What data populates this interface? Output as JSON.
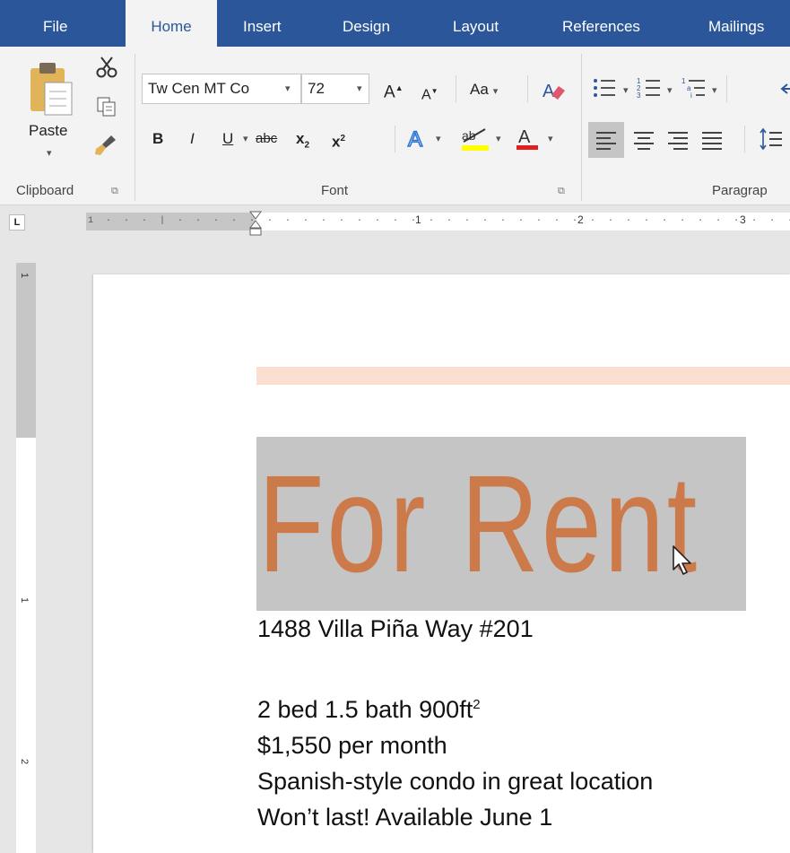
{
  "tabs": {
    "file": "File",
    "home": "Home",
    "insert": "Insert",
    "design": "Design",
    "layout": "Layout",
    "references": "References",
    "mailings": "Mailings"
  },
  "ribbon": {
    "clipboard": {
      "paste_label": "Paste",
      "group_label": "Clipboard"
    },
    "font": {
      "font_name": "Tw Cen MT Co",
      "font_size": "72",
      "change_case": "Aa",
      "bold": "B",
      "italic": "I",
      "underline": "U",
      "strikethrough": "abc",
      "subscript": "x",
      "subscript_mark": "2",
      "superscript": "x",
      "superscript_mark": "2",
      "font_color": "A",
      "group_label": "Font"
    },
    "paragraph": {
      "group_label": "Paragrap"
    }
  },
  "ruler": {
    "ticks": [
      "1",
      "2",
      "3"
    ],
    "vticks": [
      "1",
      "1",
      "2"
    ]
  },
  "document": {
    "title": "For Rent",
    "address": "1488 Villa Piña Way #201",
    "details_pre": "2 bed 1.5 bath 900ft",
    "details_sup": "2",
    "price": "$1,550 per month",
    "description": "Spanish-style condo in great location",
    "availability": "Won’t last! Available June 1"
  },
  "colors": {
    "tabbar": "#2b579a",
    "ribbon": "#f3f3f3",
    "title_text": "#cd7a4b",
    "title_selection": "#c5c5c5",
    "accent_bar": "#fbe0d2",
    "highlight_yellow": "#ffff00",
    "font_color_red": "#e02020"
  },
  "icons": {
    "paste": "clipboard-icon",
    "cut": "scissors-icon",
    "copy": "copy-icon",
    "format_painter": "brush-icon",
    "eraser": "clear-formatting-icon",
    "bullets": "bullet-list-icon",
    "numbering": "numbered-list-icon",
    "multilevel": "multilevel-list-icon",
    "align_left": "align-left-icon",
    "align_center": "align-center-icon",
    "align_right": "align-right-icon",
    "justify": "justify-icon",
    "line_spacing": "line-spacing-icon",
    "cursor": "mouse-pointer-icon"
  }
}
